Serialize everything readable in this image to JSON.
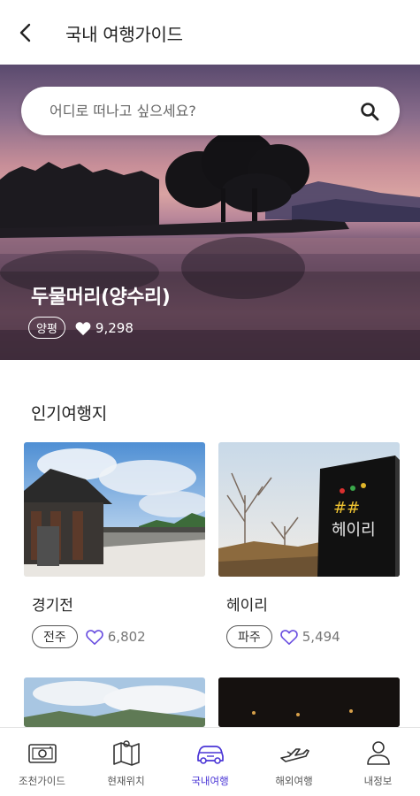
{
  "header": {
    "title": "국내 여행가이드"
  },
  "search": {
    "placeholder": "어디로 떠나고 싶으세요?"
  },
  "hero": {
    "title": "두물머리(양수리)",
    "tag": "양평",
    "likes": "9,298"
  },
  "section": {
    "title": "인기여행지"
  },
  "cards": [
    {
      "name": "경기전",
      "tag": "전주",
      "likes": "6,802"
    },
    {
      "name": "헤이리",
      "tag": "파주",
      "likes": "5,494",
      "sign_text": "헤이리"
    }
  ],
  "nav": [
    {
      "label": "조천가이드",
      "icon": "camera-icon",
      "active": false
    },
    {
      "label": "현재위치",
      "icon": "map-icon",
      "active": false
    },
    {
      "label": "국내여행",
      "icon": "car-icon",
      "active": true
    },
    {
      "label": "해외여행",
      "icon": "airplane-icon",
      "active": false
    },
    {
      "label": "내정보",
      "icon": "user-icon",
      "active": false
    }
  ],
  "colors": {
    "accent": "#4a35d6",
    "heart_outline": "#6a4fe0"
  }
}
